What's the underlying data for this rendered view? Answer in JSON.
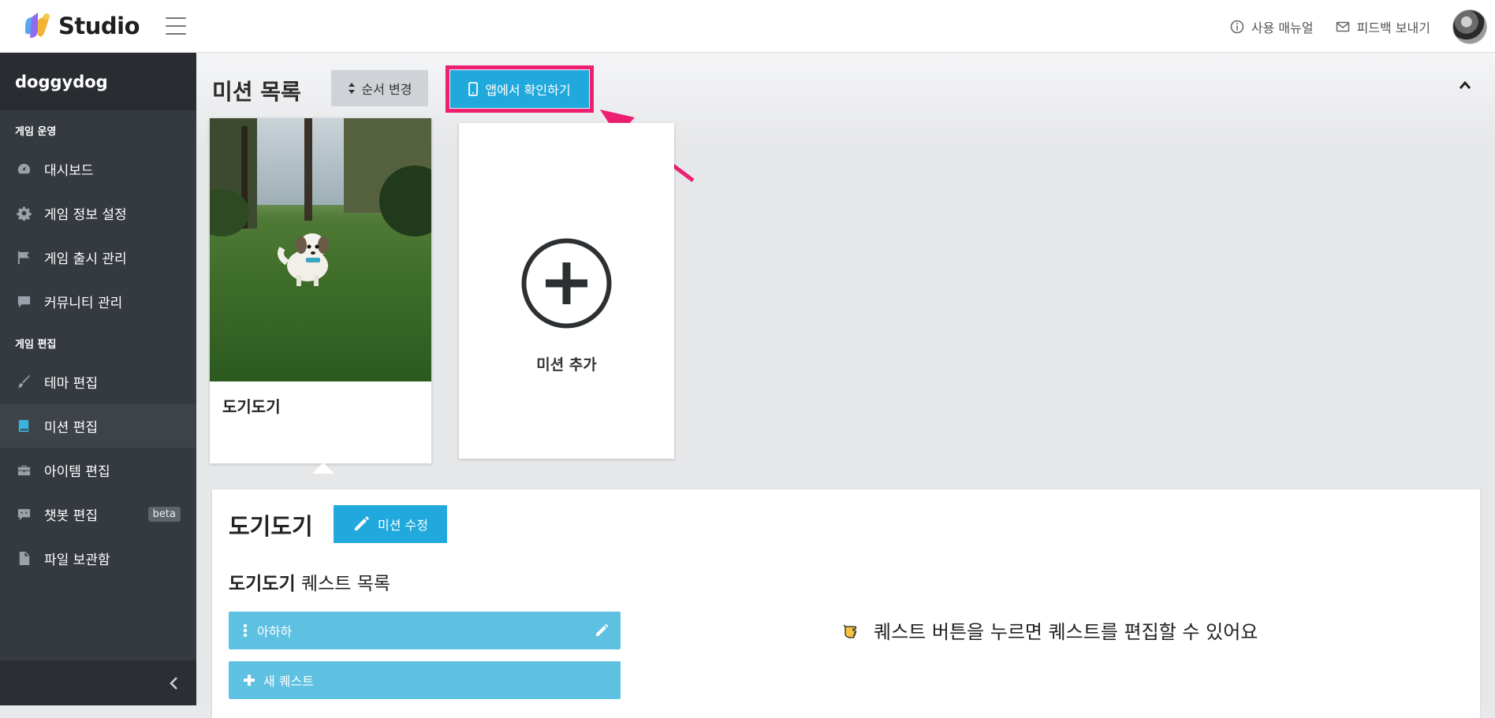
{
  "app": {
    "logo_text": "Studio"
  },
  "topbar": {
    "manual_label": "사용 매뉴얼",
    "feedback_label": "피드백 보내기"
  },
  "sidebar": {
    "project_name": "doggydog",
    "section_operate": "게임 운영",
    "section_edit": "게임 편집",
    "items_operate": [
      {
        "label": "대시보드",
        "icon": "dashboard-icon"
      },
      {
        "label": "게임 정보 설정",
        "icon": "gear-icon"
      },
      {
        "label": "게임 출시 관리",
        "icon": "flag-icon"
      },
      {
        "label": "커뮤니티 관리",
        "icon": "comment-icon"
      }
    ],
    "items_edit": [
      {
        "label": "테마 편집",
        "icon": "brush-icon"
      },
      {
        "label": "미션 편집",
        "icon": "book-icon",
        "active": true
      },
      {
        "label": "아이템 편집",
        "icon": "toolbox-icon"
      },
      {
        "label": "챗봇 편집",
        "icon": "chatbot-icon",
        "badge": "beta"
      },
      {
        "label": "파일 보관함",
        "icon": "file-icon"
      }
    ]
  },
  "main": {
    "title": "미션 목록",
    "order_button": "순서 변경",
    "app_button": "앱에서 확인하기",
    "missions": [
      {
        "name": "도기도기"
      }
    ],
    "add_mission_label": "미션 추가"
  },
  "detail": {
    "title": "도기도기",
    "edit_button": "미션 수정",
    "quest_list_name": "도기도기",
    "quest_list_suffix": "퀘스트 목록",
    "quests": [
      {
        "label": "아하하"
      }
    ],
    "new_quest_label": "새 퀘스트",
    "hint": "퀘스트 버튼을 누르면 퀘스트를 편집할 수 있어요"
  },
  "colors": {
    "accent": "#21a9dd",
    "highlight": "#ec1f71",
    "quest_bg": "#5fc1e2",
    "sidebar_bg": "#343a40"
  }
}
